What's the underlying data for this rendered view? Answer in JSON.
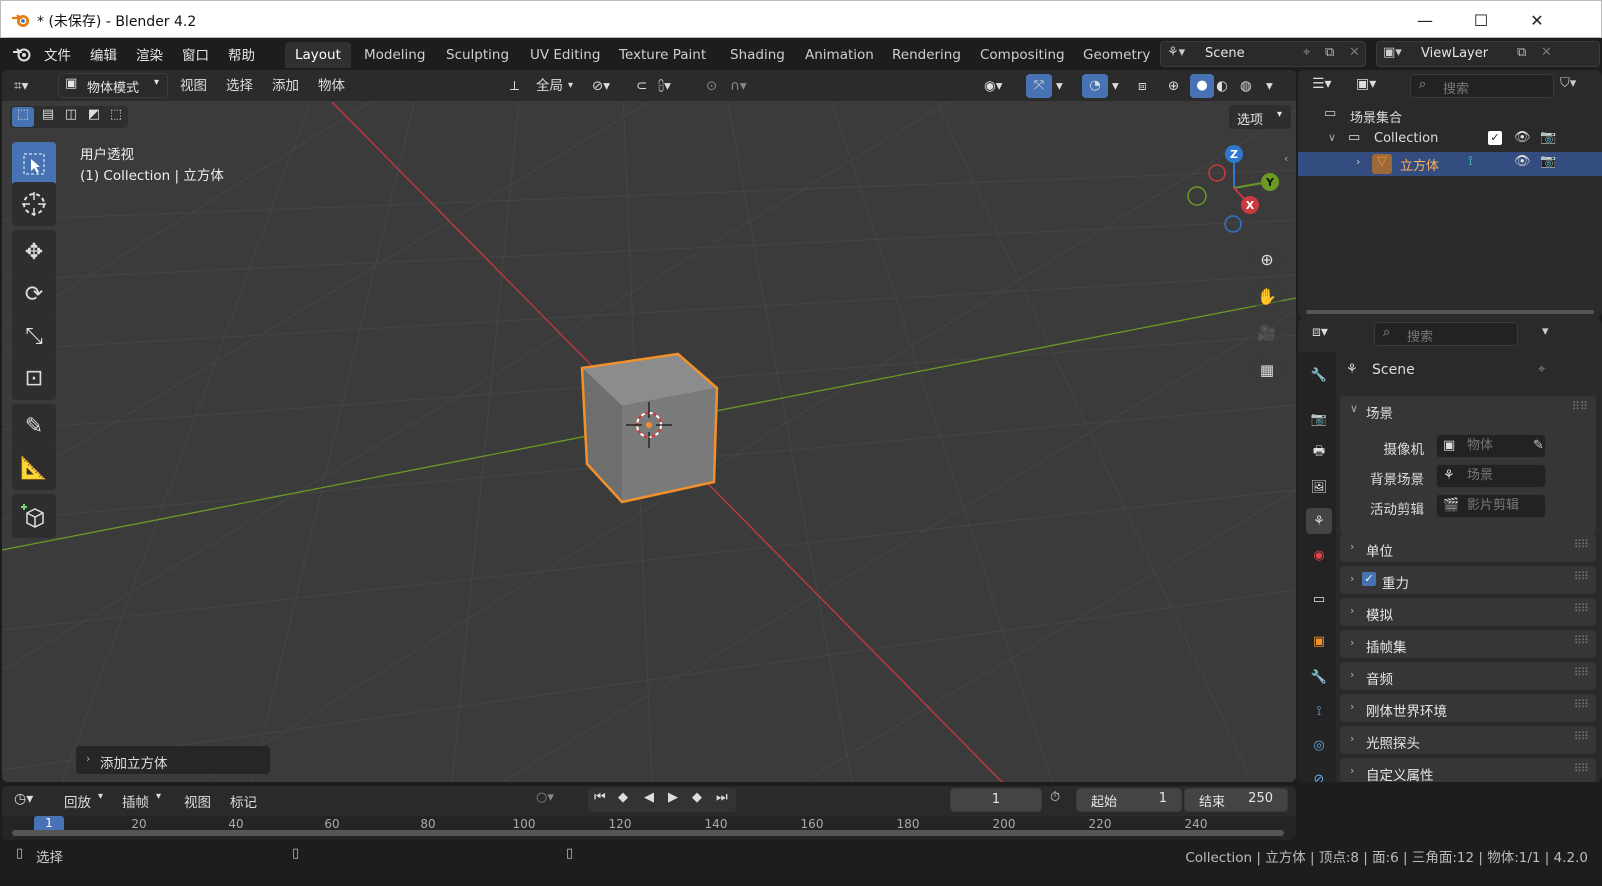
{
  "window": {
    "title": "* (未保存) - Blender 4.2",
    "controls": {
      "minimize": "—",
      "maximize": "☐",
      "close": "✕"
    }
  },
  "menubar": {
    "items": [
      "文件",
      "编辑",
      "渲染",
      "窗口",
      "帮助"
    ],
    "workspaces": [
      "Layout",
      "Modeling",
      "Sculpting",
      "UV Editing",
      "Texture Paint",
      "Shading",
      "Animation",
      "Rendering",
      "Compositing",
      "Geometry"
    ],
    "active_workspace": "Layout",
    "scene_name": "Scene",
    "view_layer": "ViewLayer"
  },
  "viewport": {
    "mode": "物体模式",
    "menus": [
      "视图",
      "选择",
      "添加",
      "物体"
    ],
    "transform_orientation": "全局",
    "options_button": "选项",
    "view_name": "用户透视",
    "collection_line": "(1) Collection | 立方体",
    "operator_panel": "添加立方体",
    "gizmo_axes": {
      "z": "Z",
      "y": "Y",
      "x": "X"
    },
    "colors": {
      "x_axis": "#c9393f",
      "y_axis": "#6a9a23",
      "z_axis": "#2f77d0",
      "selection": "#f2902c"
    }
  },
  "outliner": {
    "search_placeholder": "搜索",
    "scene_collection": "场景集合",
    "collection": "Collection",
    "object": "立方体"
  },
  "properties": {
    "search_placeholder": "搜索",
    "context_title": "Scene",
    "scene_panel": "场景",
    "fields": [
      {
        "label": "摄像机",
        "value": "物体"
      },
      {
        "label": "背景场景",
        "value": "场景"
      },
      {
        "label": "活动剪辑",
        "value": "影片剪辑"
      }
    ],
    "panels": [
      "单位",
      "重力",
      "模拟",
      "插帧集",
      "音频",
      "刚体世界环境",
      "光照探头",
      "自定义属性"
    ],
    "gravity_checked": true
  },
  "timeline": {
    "menus": [
      "回放",
      "插帧",
      "视图",
      "标记"
    ],
    "current_frame": "1",
    "start_label": "起始",
    "start_value": "1",
    "end_label": "结束",
    "end_value": "250",
    "ruler_ticks": [
      "1",
      "20",
      "40",
      "60",
      "80",
      "100",
      "120",
      "140",
      "160",
      "180",
      "200",
      "220",
      "240"
    ]
  },
  "statusbar": {
    "left_hint": "选择",
    "info": "Collection | 立方体 | 顶点:8 | 面:6 | 三角面:12 | 物体:1/1 | 4.2.0"
  }
}
